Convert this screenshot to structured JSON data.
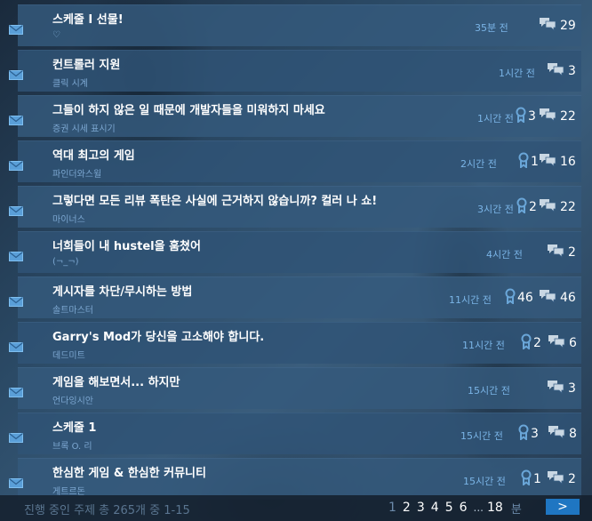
{
  "topics": [
    {
      "title": "스케줄 I 선물!",
      "author": "♡",
      "time": "35분 전",
      "awards": "",
      "replies": "29"
    },
    {
      "title": "컨트롤러 지원",
      "author": "클릭 시계",
      "time": "1시간 전",
      "awards": "",
      "replies": "3"
    },
    {
      "title": "그들이 하지 않은 일 때문에 개발자들을 미워하지 마세요",
      "author": "증권 시세 표시기",
      "time": "1시간 전",
      "awards": "3",
      "replies": "22"
    },
    {
      "title": "역대 최고의 게임",
      "author": "파인더와스윌",
      "time": "2시간 전",
      "awards": "1",
      "replies": "16"
    },
    {
      "title": "그렇다면 모든 리뷰 폭탄은 사실에 근거하지 않습니까? 컬러 나 쇼!",
      "author": "마이너스",
      "time": "3시간 전",
      "awards": "2",
      "replies": "22"
    },
    {
      "title": "너희들이 내 hustel을 훔쳤어",
      "author": "(¬_¬)",
      "time": "4시간 전",
      "awards": "",
      "replies": "2"
    },
    {
      "title": "게시자를 차단/무시하는 방법",
      "author": "솔트마스터",
      "time": "11시간 전",
      "awards": "46",
      "replies": "46"
    },
    {
      "title": "Garry's Mod가 당신을 고소해야 합니다.",
      "author": "데드미트",
      "time": "11시간 전",
      "awards": "2",
      "replies": "6"
    },
    {
      "title": "게임을 해보면서... 하지만",
      "author": "언다잉시안",
      "time": "15시간 전",
      "awards": "",
      "replies": "3"
    },
    {
      "title": "스케줄 1",
      "author": "브록 O. 리",
      "time": "15시간 전",
      "awards": "3",
      "replies": "8"
    },
    {
      "title": "한심한 게임 & 한심한 커뮤니티",
      "author": "게트르돈",
      "time": "15시간 전",
      "awards": "1",
      "replies": "2"
    }
  ],
  "footer": {
    "count_text": "진행 중인 주제 총 265개 중 1-15",
    "pages": [
      "1",
      "2",
      "3",
      "4",
      "5",
      "6"
    ],
    "ellipsis": "...",
    "last_page": "18",
    "unit": "분",
    "next_label": ">"
  },
  "colors": {
    "accent": "#1f76c2",
    "time": "#7ab4e6",
    "author": "#7ca7d1",
    "award": "#6aa6d8"
  },
  "icons": {
    "topic": "mail-icon",
    "award": "award-ribbon-icon",
    "reply": "speech-bubbles-icon",
    "next": "chevron-right-icon"
  }
}
